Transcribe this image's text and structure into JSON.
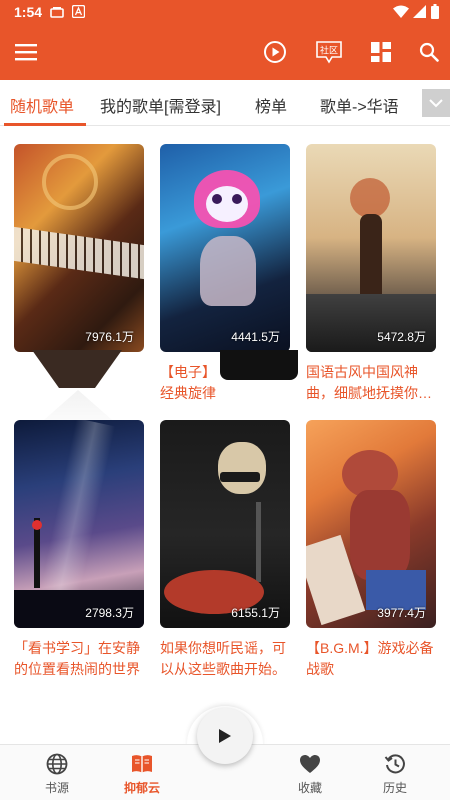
{
  "status_bar": {
    "time": "1:54"
  },
  "app_bar": {
    "community_label": "社区",
    "accent_color": "#e8552a"
  },
  "tabs": [
    {
      "label": "随机歌单",
      "active": true
    },
    {
      "label": "我的歌单[需登录]",
      "active": false
    },
    {
      "label": "榜单",
      "active": false
    },
    {
      "label": "歌单->华语",
      "active": false
    }
  ],
  "playlists": [
    {
      "count": "7976.1万",
      "title": ""
    },
    {
      "count": "4441.5万",
      "title": "【电子】\n经典旋律"
    },
    {
      "count": "5472.8万",
      "title": "国语古风中国风神曲，细腻地抚摸你…"
    },
    {
      "count": "2798.3万",
      "title": "「看书学习」在安静的位置看热闹的世界"
    },
    {
      "count": "6155.1万",
      "title": "如果你想听民谣，可以从这些歌曲开始。"
    },
    {
      "count": "3977.4万",
      "title": "【B.G.M.】游戏必备战歌"
    }
  ],
  "bottom_nav": [
    {
      "label": "书源",
      "icon": "globe-icon",
      "active": false
    },
    {
      "label": "抑郁云",
      "icon": "book-icon",
      "active": true
    },
    {
      "label": "收藏",
      "icon": "heart-icon",
      "active": false
    },
    {
      "label": "历史",
      "icon": "history-icon",
      "active": false
    }
  ]
}
